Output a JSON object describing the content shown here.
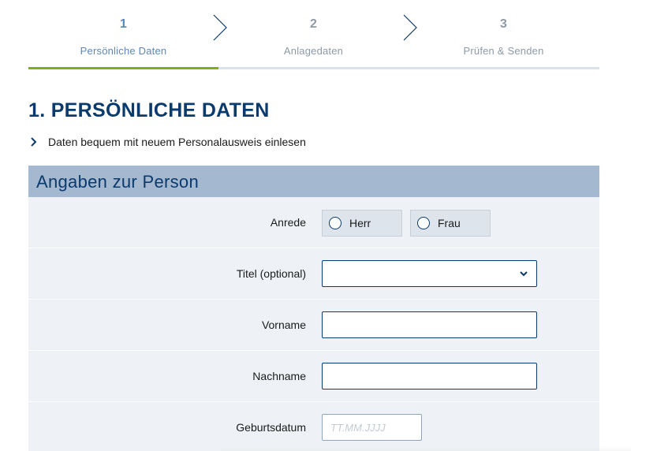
{
  "stepper": {
    "steps": [
      {
        "number": "1",
        "label": "Persönliche Daten"
      },
      {
        "number": "2",
        "label": "Anlagedaten"
      },
      {
        "number": "3",
        "label": "Prüfen & Senden"
      }
    ],
    "current_step": 1,
    "total_steps": 3
  },
  "section": {
    "title": "1. PERSÖNLICHE DATEN",
    "id_card_link": "Daten bequem mit neuem Personalausweis einlesen"
  },
  "panel": {
    "title": "Angaben zur Person",
    "salutation": {
      "label": "Anrede",
      "options": [
        "Herr",
        "Frau"
      ],
      "selected": null
    },
    "title_field": {
      "label": "Titel (optional)",
      "value": ""
    },
    "first_name": {
      "label": "Vorname",
      "value": ""
    },
    "last_name": {
      "label": "Nachname",
      "value": ""
    },
    "birth_date": {
      "label": "Geburtsdatum",
      "value": "",
      "placeholder": "TT.MM.JJJJ"
    }
  },
  "colors": {
    "brand_navy": "#0b3a6c",
    "active_step_blue": "#5b88b8",
    "inactive_step_gray": "#8d9aa9",
    "progress_green": "#7fae1b",
    "panel_header": "#a4b8d0",
    "panel_body": "#eef2f6"
  },
  "icons": {
    "step_separator": "chevron-right-icon",
    "link_arrow": "chevron-right-icon",
    "select_caret": "chevron-down-icon",
    "radio": "radio-unchecked-icon"
  }
}
